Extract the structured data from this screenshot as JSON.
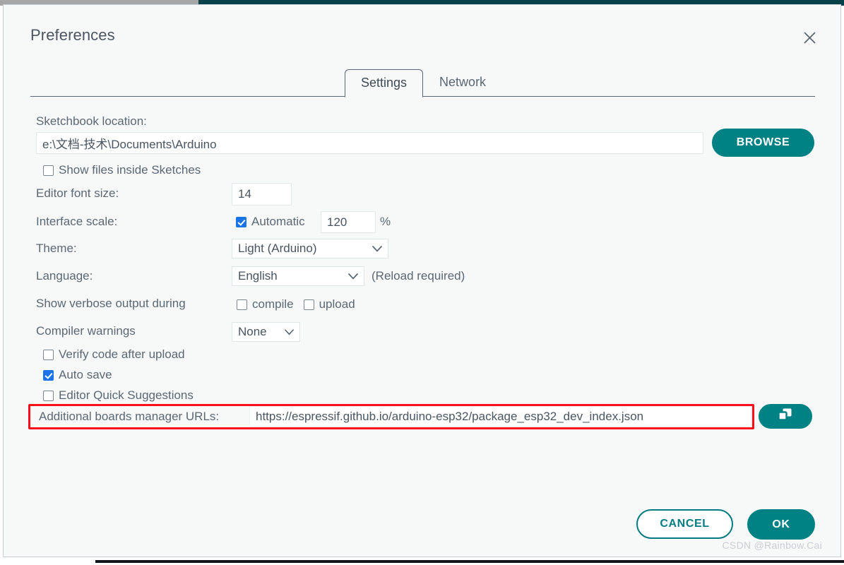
{
  "window": {
    "title": "Preferences",
    "close_icon": "close-icon"
  },
  "tabs": [
    {
      "label": "Settings",
      "active": true
    },
    {
      "label": "Network",
      "active": false
    }
  ],
  "settings": {
    "sketchbook": {
      "label": "Sketchbook location:",
      "value": "e:\\文档-技术\\Documents\\Arduino",
      "browse_label": "BROWSE"
    },
    "show_files_inside_sketches": {
      "label": "Show files inside Sketches",
      "checked": false
    },
    "editor_font_size": {
      "label": "Editor font size:",
      "value": "14"
    },
    "interface_scale": {
      "label": "Interface scale:",
      "automatic_label": "Automatic",
      "automatic_checked": true,
      "value": "120",
      "unit": "%"
    },
    "theme": {
      "label": "Theme:",
      "value": "Light (Arduino)"
    },
    "language": {
      "label": "Language:",
      "value": "English",
      "note": "(Reload required)"
    },
    "verbose_output": {
      "label": "Show verbose output during",
      "compile_label": "compile",
      "compile_checked": false,
      "upload_label": "upload",
      "upload_checked": false
    },
    "compiler_warnings": {
      "label": "Compiler warnings",
      "value": "None"
    },
    "verify_code_after_upload": {
      "label": "Verify code after upload",
      "checked": false
    },
    "auto_save": {
      "label": "Auto save",
      "checked": true
    },
    "editor_quick_suggestions": {
      "label": "Editor Quick Suggestions",
      "checked": false
    },
    "additional_urls": {
      "label": "Additional boards manager URLs:",
      "value": "https://espressif.github.io/arduino-esp32/package_esp32_dev_index.json",
      "edit_icon": "open-window-icon"
    }
  },
  "footer": {
    "cancel_label": "CANCEL",
    "ok_label": "OK"
  },
  "watermark": "CSDN @Rainbow.Cai",
  "colors": {
    "accent_teal": "#008184",
    "checkbox_blue": "#1a73e8",
    "highlight_red": "#fc0d1b",
    "title_bar_teal": "#00414a",
    "dialog_bg": "#f7f9f9"
  }
}
